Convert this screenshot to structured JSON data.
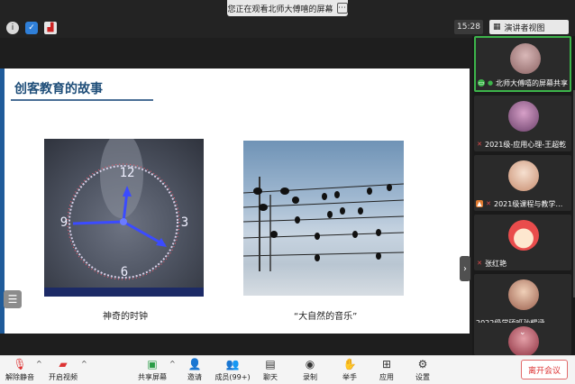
{
  "window": {
    "share_banner": "您正在观看北师大傅嘻的屏幕",
    "time": "15:28",
    "view_mode": "演讲者视图"
  },
  "slide": {
    "title": "创客教育的故事",
    "caption_left": "神奇的时钟",
    "caption_right": "“大自然的音乐”",
    "clock_numbers": [
      "12",
      "3",
      "6",
      "9"
    ]
  },
  "participants": [
    {
      "name": "北师大傅嘻的屏幕共享",
      "active": true,
      "avatar_color": "#b8898a"
    },
    {
      "name": "2021级-应用心理-王超乾",
      "active": false,
      "avatar_color": "#8e5f8a"
    },
    {
      "name": "2021级课程与教学…",
      "active": false,
      "avatar_color": "#e8b8a0"
    },
    {
      "name": "张红艳",
      "active": false,
      "avatar_color": "#e94c4c"
    },
    {
      "name": "2022级学硕班孙耀涵",
      "active": false,
      "avatar_color": "#c98c7a"
    },
    {
      "name": "",
      "active": false,
      "avatar_color": "#b74a5a"
    }
  ],
  "toolbar": {
    "mute": "解除静音",
    "video": "开启视频",
    "share": "共享屏幕",
    "invite": "邀请",
    "members": "成员(99+)",
    "chat": "聊天",
    "record": "录制",
    "raise_hand": "举手",
    "apps": "应用",
    "settings": "设置",
    "leave": "离开会议"
  },
  "colors": {
    "accent_green": "#3cb44a",
    "leave_red": "#d33333",
    "slide_title": "#1f4e79"
  }
}
